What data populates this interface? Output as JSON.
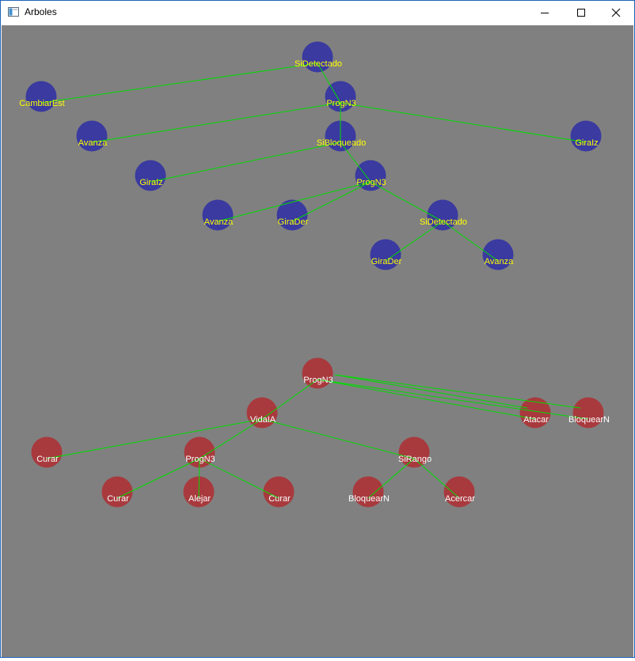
{
  "window": {
    "title": "Arboles"
  },
  "colors": {
    "background": "#808080",
    "edge": "#00dd00",
    "blue_node": "#3a3aa0",
    "blue_label": "#ffff00",
    "red_node": "#a83a3e",
    "red_label": "#ffffff"
  },
  "trees": [
    {
      "name": "blue-tree",
      "nodes": [
        {
          "label": "SiDetectado"
        },
        {
          "label": "CambiarEst"
        },
        {
          "label": "ProgN3"
        },
        {
          "label": "Avanza"
        },
        {
          "label": "SiBloqueado"
        },
        {
          "label": "GiraIz"
        },
        {
          "label": "GiraIz"
        },
        {
          "label": "ProgN3"
        },
        {
          "label": "Avanza"
        },
        {
          "label": "GiraDer"
        },
        {
          "label": "SiDetectado"
        },
        {
          "label": "GiraDer"
        },
        {
          "label": "Avanza"
        }
      ]
    },
    {
      "name": "red-tree",
      "nodes": [
        {
          "label": "ProgN3"
        },
        {
          "label": "VidaIA"
        },
        {
          "label": "Atacar"
        },
        {
          "label": "BloquearN"
        },
        {
          "label": "Curar"
        },
        {
          "label": "ProgN3"
        },
        {
          "label": "SiRango"
        },
        {
          "label": "Curar"
        },
        {
          "label": "Alejar"
        },
        {
          "label": "Curar"
        },
        {
          "label": "BloquearN"
        },
        {
          "label": "Acercar"
        }
      ]
    }
  ]
}
